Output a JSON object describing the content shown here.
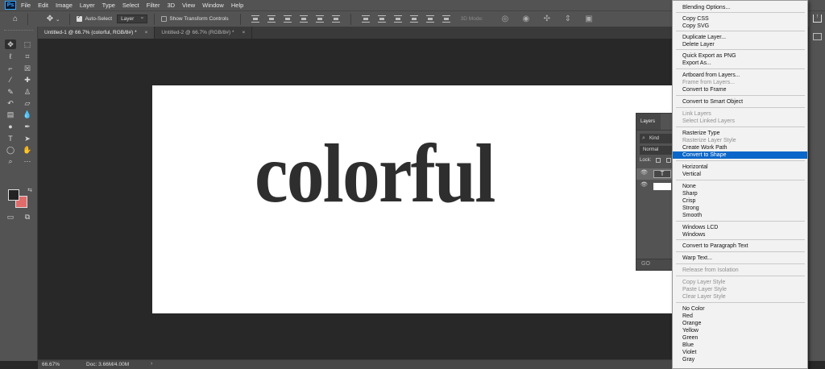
{
  "app": {
    "logo": "Ps"
  },
  "menu": [
    "File",
    "Edit",
    "Image",
    "Layer",
    "Type",
    "Select",
    "Filter",
    "3D",
    "View",
    "Window",
    "Help"
  ],
  "options": {
    "auto_select_label": "Auto-Select",
    "auto_select_value": "Layer",
    "transform_label": "Show Transform Controls",
    "mode_3d": "3D Mode:"
  },
  "tabs": [
    {
      "label": "Untitled-1 @ 66.7% (colorful, RGB/8#) *",
      "close": "×"
    },
    {
      "label": "Untitled-2 @ 66.7% (RGB/8#) *",
      "close": "×"
    }
  ],
  "canvas": {
    "text": "colorful"
  },
  "colors": {
    "foreground": "#222222",
    "background": "#e06b6b",
    "menu_highlight": "#0a66c8"
  },
  "layers_panel": {
    "title": "Layers",
    "filter_kind": "Kind",
    "blend_mode": "Normal",
    "lock_label": "Lock:",
    "text_thumb": "T",
    "footer_link": "GO"
  },
  "context_menu": {
    "items": [
      {
        "label": "Blending Options...",
        "disabled": false
      },
      {
        "label": "Copy CSS",
        "disabled": false
      },
      {
        "label": "Copy SVG",
        "disabled": false
      },
      {
        "label": "Duplicate Layer...",
        "disabled": false
      },
      {
        "label": "Delete Layer",
        "disabled": false
      },
      {
        "label": "Quick Export as PNG",
        "disabled": false
      },
      {
        "label": "Export As...",
        "disabled": false
      },
      {
        "label": "Artboard from Layers...",
        "disabled": false
      },
      {
        "label": "Frame from Layers...",
        "disabled": true
      },
      {
        "label": "Convert to Frame",
        "disabled": false
      },
      {
        "label": "Convert to Smart Object",
        "disabled": false
      },
      {
        "label": "Link Layers",
        "disabled": true
      },
      {
        "label": "Select Linked Layers",
        "disabled": true
      },
      {
        "label": "Rasterize Type",
        "disabled": false
      },
      {
        "label": "Rasterize Layer Style",
        "disabled": true
      },
      {
        "label": "Create Work Path",
        "disabled": false
      },
      {
        "label": "Convert to Shape",
        "disabled": false,
        "highlighted": true
      },
      {
        "label": "Horizontal",
        "disabled": false
      },
      {
        "label": "Vertical",
        "disabled": false
      },
      {
        "label": "None",
        "disabled": false
      },
      {
        "label": "Sharp",
        "disabled": false
      },
      {
        "label": "Crisp",
        "disabled": false
      },
      {
        "label": "Strong",
        "disabled": false
      },
      {
        "label": "Smooth",
        "disabled": false
      },
      {
        "label": "Windows LCD",
        "disabled": false
      },
      {
        "label": "Windows",
        "disabled": false
      },
      {
        "label": "Convert to Paragraph Text",
        "disabled": false
      },
      {
        "label": "Warp Text...",
        "disabled": false
      },
      {
        "label": "Release from Isolation",
        "disabled": true
      },
      {
        "label": "Copy Layer Style",
        "disabled": true
      },
      {
        "label": "Paste Layer Style",
        "disabled": true
      },
      {
        "label": "Clear Layer Style",
        "disabled": true
      },
      {
        "label": "No Color",
        "disabled": false
      },
      {
        "label": "Red",
        "disabled": false
      },
      {
        "label": "Orange",
        "disabled": false
      },
      {
        "label": "Yellow",
        "disabled": false
      },
      {
        "label": "Green",
        "disabled": false
      },
      {
        "label": "Blue",
        "disabled": false
      },
      {
        "label": "Violet",
        "disabled": false
      },
      {
        "label": "Gray",
        "disabled": false
      }
    ]
  },
  "status": {
    "zoom": "66.67%",
    "doc_info": "Doc: 3.66M/4.00M",
    "chevron": "›"
  },
  "icons": [
    "home-icon",
    "move-icon",
    "share-icon",
    "eye-icon"
  ]
}
